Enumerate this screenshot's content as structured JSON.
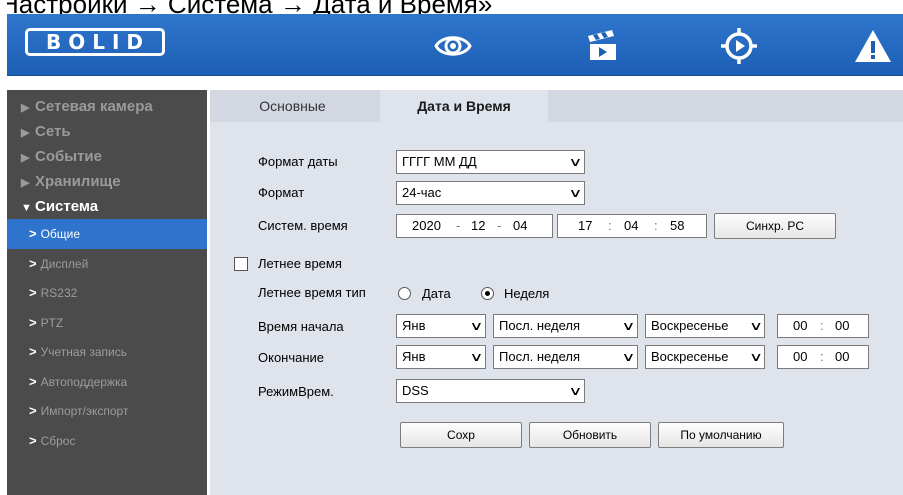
{
  "doc_caption": "Настройки → Система → Дата и Время»",
  "header": {
    "logo_text": "BOLID",
    "icons": [
      "eye-icon",
      "video-icon",
      "ptz-target-icon",
      "alarm-warning-icon"
    ]
  },
  "sidebar": {
    "sections": [
      {
        "label": "Сетевая камера",
        "open": false
      },
      {
        "label": "Сеть",
        "open": false
      },
      {
        "label": "Событие",
        "open": false
      },
      {
        "label": "Хранилище",
        "open": false
      },
      {
        "label": "Система",
        "open": true
      }
    ],
    "sub_items": [
      {
        "label": "Общие",
        "active": true
      },
      {
        "label": "Дисплей"
      },
      {
        "label": "RS232"
      },
      {
        "label": "PTZ"
      },
      {
        "label": "Учетная запись"
      },
      {
        "label": "Автоподдержка"
      },
      {
        "label": "Импорт/экспорт"
      },
      {
        "label": "Сброс"
      }
    ]
  },
  "tabs": [
    {
      "label": "Основные",
      "active": false
    },
    {
      "label": "Дата и Время",
      "active": true
    }
  ],
  "form": {
    "date_format": {
      "label": "Формат даты",
      "value": "ГГГГ ММ ДД"
    },
    "time_format": {
      "label": "Формат",
      "value": "24-час"
    },
    "system_time": {
      "label": "Систем. время",
      "year": "2020",
      "month": "12",
      "day": "04",
      "hour": "17",
      "minute": "04",
      "second": "58",
      "date_sep": "-",
      "time_sep": ":",
      "sync_button": "Синхр. PC"
    },
    "dst": {
      "label": "Летнее время",
      "checked": false
    },
    "dst_type": {
      "label": "Летнее время тип",
      "options": [
        "Дата",
        "Неделя"
      ],
      "selected": "Неделя"
    },
    "start_time": {
      "label": "Время начала",
      "month": "Янв",
      "week": "Посл. неделя",
      "day": "Воскресенье",
      "hour": "00",
      "minute": "00"
    },
    "end_time": {
      "label": "Окончание",
      "month": "Янв",
      "week": "Посл. неделя",
      "day": "Воскресенье",
      "hour": "00",
      "minute": "00"
    },
    "time_mode": {
      "label": "РежимВрем.",
      "value": "DSS"
    }
  },
  "buttons": {
    "save": "Сохр",
    "refresh": "Обновить",
    "default": "По умолчанию"
  },
  "colors": {
    "header": "#2468c4",
    "sidebar_bg": "#4b4b4b",
    "active_item": "#2f74cc",
    "content_bg": "#dfe3ec"
  }
}
